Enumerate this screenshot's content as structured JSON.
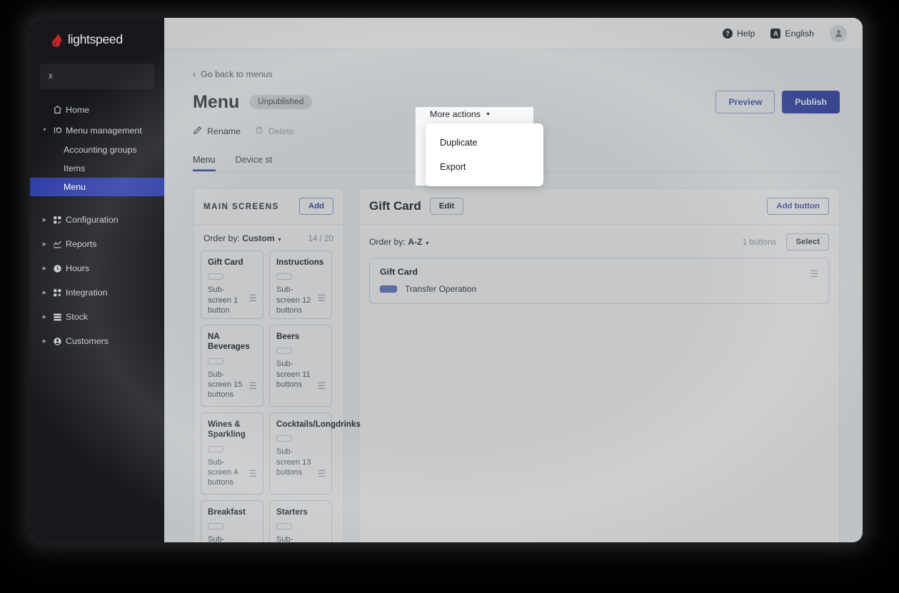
{
  "brand": {
    "name": "lightspeed",
    "logo_icon": "flame-icon",
    "accent": "#2c3aa8",
    "logo_color": "#c8262b"
  },
  "sidebar": {
    "search": {
      "value": "x",
      "placeholder": ""
    },
    "items": [
      {
        "label": "Home",
        "icon": "home-icon",
        "expandable": false,
        "active": false
      },
      {
        "label": "Menu management",
        "icon": "menu-management-icon",
        "expandable": true,
        "active": false
      },
      {
        "label": "Configuration",
        "icon": "configuration-icon",
        "expandable": true,
        "active": false
      },
      {
        "label": "Reports",
        "icon": "reports-icon",
        "expandable": true,
        "active": false
      },
      {
        "label": "Hours",
        "icon": "clock-icon",
        "expandable": true,
        "active": false
      },
      {
        "label": "Integration",
        "icon": "integration-icon",
        "expandable": true,
        "active": false
      },
      {
        "label": "Stock",
        "icon": "stock-icon",
        "expandable": true,
        "active": false
      },
      {
        "label": "Customers",
        "icon": "customers-icon",
        "expandable": true,
        "active": false
      }
    ],
    "subitems": [
      {
        "label": "Accounting groups",
        "active": false
      },
      {
        "label": "Items",
        "active": false
      },
      {
        "label": "Menu",
        "active": true
      }
    ]
  },
  "topbar": {
    "help": {
      "label": "Help",
      "icon": "help-circle-icon",
      "glyph": "?"
    },
    "language": {
      "label": "English",
      "icon": "translate-icon",
      "glyph": "A"
    },
    "avatar": {
      "icon": "user-avatar-icon"
    }
  },
  "page": {
    "back_link": "Go back to menus",
    "back_icon": "chevron-left-icon",
    "title": "Menu",
    "status_badge": "Unpublished",
    "preview_button": "Preview",
    "publish_button": "Publish"
  },
  "actions": {
    "rename": {
      "label": "Rename",
      "icon": "pencil-icon"
    },
    "delete": {
      "label": "Delete",
      "icon": "trash-icon",
      "disabled": true
    },
    "more": {
      "label": "More actions",
      "icon": "chevron-down-icon"
    },
    "dropdown_items": [
      {
        "label": "Duplicate"
      },
      {
        "label": "Export"
      }
    ]
  },
  "tabs": [
    {
      "label": "Menu",
      "active": true
    },
    {
      "label": "Device st",
      "active": false
    }
  ],
  "left_panel": {
    "header": "MAIN SCREENS",
    "add_button": "Add",
    "order_by_prefix": "Order by:",
    "order_by_value": "Custom",
    "count": "14 / 20",
    "cards": [
      {
        "title": "Gift Card",
        "type": "Sub-screen",
        "buttons": "1 button"
      },
      {
        "title": "Instructions",
        "type": "Sub-screen",
        "buttons": "12 buttons"
      },
      {
        "title": "NA Beverages",
        "type": "Sub-screen",
        "buttons": "15 buttons"
      },
      {
        "title": "Beers",
        "type": "Sub-screen",
        "buttons": "11 buttons"
      },
      {
        "title": "Wines & Sparkling",
        "type": "Sub-screen",
        "buttons": "4 buttons"
      },
      {
        "title": "Cocktails/Longdrinks",
        "type": "Sub-screen",
        "buttons": "13 buttons"
      },
      {
        "title": "Breakfast",
        "type": "Sub-screen",
        "buttons": ""
      },
      {
        "title": "Starters",
        "type": "Sub-screen",
        "buttons": ""
      }
    ]
  },
  "right_panel": {
    "title": "Gift Card",
    "edit_button": "Edit",
    "add_button": "Add button",
    "order_by_prefix": "Order by:",
    "order_by_value": "A-Z",
    "count": "1 buttons",
    "select_button": "Select",
    "buttons": [
      {
        "title": "Gift Card",
        "action_label": "Transfer Operation",
        "chip_color": "#6471c4"
      }
    ]
  }
}
